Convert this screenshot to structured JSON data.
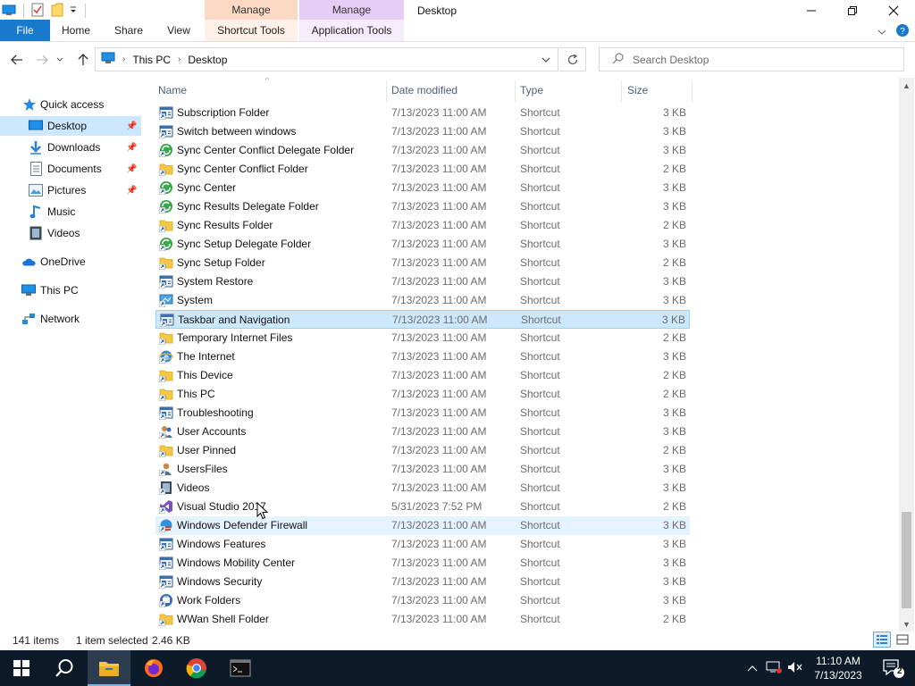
{
  "window": {
    "title": "Desktop",
    "contextual_tabs": [
      {
        "label": "Manage",
        "sub": "Shortcut Tools"
      },
      {
        "label": "Manage",
        "sub": "Application Tools"
      }
    ]
  },
  "ribbon": {
    "tabs": [
      "File",
      "Home",
      "Share",
      "View",
      "Shortcut Tools",
      "Application Tools"
    ]
  },
  "address": {
    "crumbs": [
      "This PC",
      "Desktop"
    ],
    "search_placeholder": "Search Desktop"
  },
  "nav": {
    "quick_access": "Quick access",
    "items": [
      {
        "label": "Desktop",
        "icon": "desktop-icon",
        "pinned": true,
        "selected": true
      },
      {
        "label": "Downloads",
        "icon": "downloads-icon",
        "pinned": true
      },
      {
        "label": "Documents",
        "icon": "documents-icon",
        "pinned": true
      },
      {
        "label": "Pictures",
        "icon": "pictures-icon",
        "pinned": true
      },
      {
        "label": "Music",
        "icon": "music-icon"
      },
      {
        "label": "Videos",
        "icon": "videos-icon"
      }
    ],
    "onedrive": "OneDrive",
    "this_pc": "This PC",
    "network": "Network"
  },
  "columns": {
    "name": "Name",
    "date": "Date modified",
    "type": "Type",
    "size": "Size"
  },
  "files": [
    {
      "name": "Subscription Folder",
      "date": "7/13/2023 11:00 AM",
      "type": "Shortcut",
      "size": "3 KB",
      "icon": "cp"
    },
    {
      "name": "Switch between windows",
      "date": "7/13/2023 11:00 AM",
      "type": "Shortcut",
      "size": "3 KB",
      "icon": "cp"
    },
    {
      "name": "Sync Center Conflict Delegate Folder",
      "date": "7/13/2023 11:00 AM",
      "type": "Shortcut",
      "size": "3 KB",
      "icon": "sync"
    },
    {
      "name": "Sync Center Conflict Folder",
      "date": "7/13/2023 11:00 AM",
      "type": "Shortcut",
      "size": "2 KB",
      "icon": "folder"
    },
    {
      "name": "Sync Center",
      "date": "7/13/2023 11:00 AM",
      "type": "Shortcut",
      "size": "3 KB",
      "icon": "sync"
    },
    {
      "name": "Sync Results Delegate Folder",
      "date": "7/13/2023 11:00 AM",
      "type": "Shortcut",
      "size": "3 KB",
      "icon": "sync"
    },
    {
      "name": "Sync Results Folder",
      "date": "7/13/2023 11:00 AM",
      "type": "Shortcut",
      "size": "2 KB",
      "icon": "folder"
    },
    {
      "name": "Sync Setup Delegate Folder",
      "date": "7/13/2023 11:00 AM",
      "type": "Shortcut",
      "size": "3 KB",
      "icon": "sync"
    },
    {
      "name": "Sync Setup Folder",
      "date": "7/13/2023 11:00 AM",
      "type": "Shortcut",
      "size": "2 KB",
      "icon": "folder"
    },
    {
      "name": "System Restore",
      "date": "7/13/2023 11:00 AM",
      "type": "Shortcut",
      "size": "3 KB",
      "icon": "cp"
    },
    {
      "name": "System",
      "date": "7/13/2023 11:00 AM",
      "type": "Shortcut",
      "size": "3 KB",
      "icon": "system"
    },
    {
      "name": "Taskbar and Navigation",
      "date": "7/13/2023 11:00 AM",
      "type": "Shortcut",
      "size": "3 KB",
      "icon": "cp",
      "selected": true
    },
    {
      "name": "Temporary Internet Files",
      "date": "7/13/2023 11:00 AM",
      "type": "Shortcut",
      "size": "2 KB",
      "icon": "folder"
    },
    {
      "name": "The Internet",
      "date": "7/13/2023 11:00 AM",
      "type": "Shortcut",
      "size": "3 KB",
      "icon": "ie"
    },
    {
      "name": "This Device",
      "date": "7/13/2023 11:00 AM",
      "type": "Shortcut",
      "size": "2 KB",
      "icon": "folder"
    },
    {
      "name": "This PC",
      "date": "7/13/2023 11:00 AM",
      "type": "Shortcut",
      "size": "2 KB",
      "icon": "folder"
    },
    {
      "name": "Troubleshooting",
      "date": "7/13/2023 11:00 AM",
      "type": "Shortcut",
      "size": "3 KB",
      "icon": "cp"
    },
    {
      "name": "User Accounts",
      "date": "7/13/2023 11:00 AM",
      "type": "Shortcut",
      "size": "3 KB",
      "icon": "users"
    },
    {
      "name": "User Pinned",
      "date": "7/13/2023 11:00 AM",
      "type": "Shortcut",
      "size": "2 KB",
      "icon": "folder"
    },
    {
      "name": "UsersFiles",
      "date": "7/13/2023 11:00 AM",
      "type": "Shortcut",
      "size": "3 KB",
      "icon": "user"
    },
    {
      "name": "Videos",
      "date": "7/13/2023 11:00 AM",
      "type": "Shortcut",
      "size": "3 KB",
      "icon": "videos"
    },
    {
      "name": "Visual Studio 2017",
      "date": "5/31/2023 7:52 PM",
      "type": "Shortcut",
      "size": "2 KB",
      "icon": "vs"
    },
    {
      "name": "Windows Defender Firewall",
      "date": "7/13/2023 11:00 AM",
      "type": "Shortcut",
      "size": "3 KB",
      "icon": "firewall",
      "hover": true
    },
    {
      "name": "Windows Features",
      "date": "7/13/2023 11:00 AM",
      "type": "Shortcut",
      "size": "3 KB",
      "icon": "cp"
    },
    {
      "name": "Windows Mobility Center",
      "date": "7/13/2023 11:00 AM",
      "type": "Shortcut",
      "size": "3 KB",
      "icon": "cp"
    },
    {
      "name": "Windows Security",
      "date": "7/13/2023 11:00 AM",
      "type": "Shortcut",
      "size": "3 KB",
      "icon": "cp"
    },
    {
      "name": "Work Folders",
      "date": "7/13/2023 11:00 AM",
      "type": "Shortcut",
      "size": "3 KB",
      "icon": "work"
    },
    {
      "name": "WWan Shell Folder",
      "date": "7/13/2023 11:00 AM",
      "type": "Shortcut",
      "size": "2 KB",
      "icon": "folder"
    }
  ],
  "status": {
    "items": "141 items",
    "selected": "1 item selected",
    "size": "2.46 KB"
  },
  "taskbar": {
    "apps": [
      "start",
      "search",
      "file-explorer",
      "firefox",
      "chrome",
      "terminal"
    ],
    "time": "11:10 AM",
    "date": "7/13/2023",
    "notifications": "2"
  },
  "colors": {
    "accent": "#1979ca",
    "selection": "#cce8ff",
    "hover": "#e5f3ff",
    "taskbar": "#0d1a29"
  }
}
